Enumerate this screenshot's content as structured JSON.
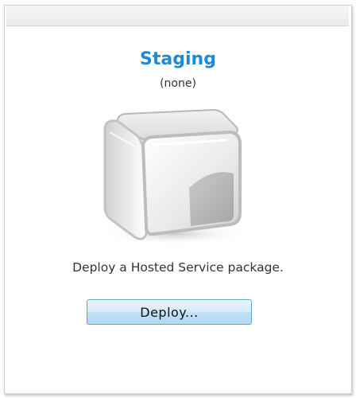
{
  "section": {
    "title": "Staging",
    "status": "(none)",
    "description": "Deploy a Hosted Service package."
  },
  "actions": {
    "deploy_label": "Deploy..."
  },
  "colors": {
    "title": "#1c8ad6",
    "button_border": "#5fa4cf"
  },
  "icons": {
    "package": "empty-box-icon"
  }
}
